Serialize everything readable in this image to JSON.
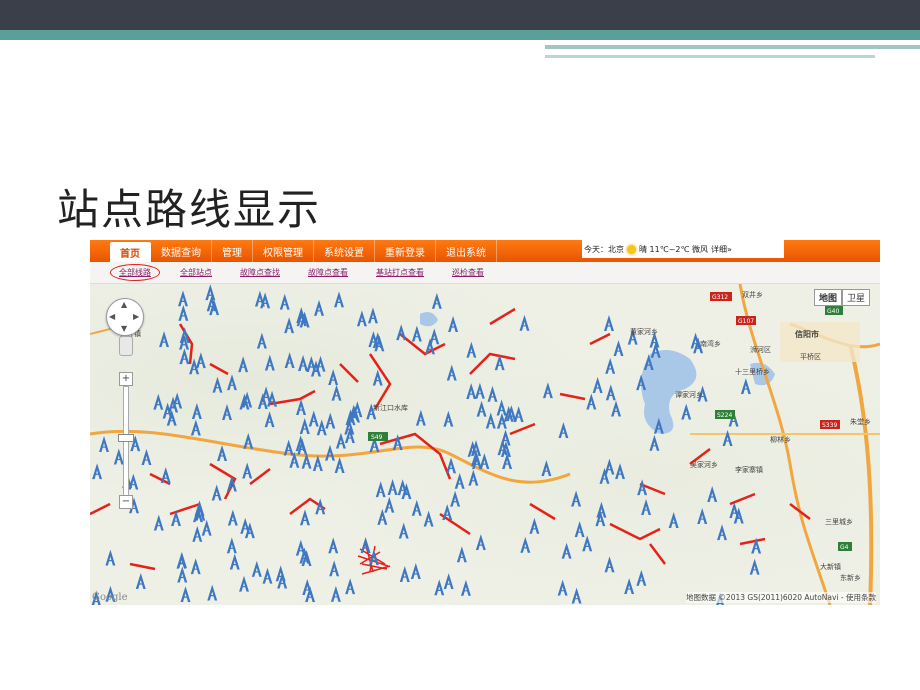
{
  "slide": {
    "title": "站点路线显示"
  },
  "menu": {
    "items": [
      "首页",
      "数据查询",
      "管理",
      "权限管理",
      "系统设置",
      "重新登录",
      "退出系统"
    ],
    "weather": {
      "label": "今天：北京",
      "condition": "晴 11℃~2℃ 微风",
      "details": "详细»"
    }
  },
  "subnav": {
    "items": [
      "全部线路",
      "全部站点",
      "故障点查找",
      "故障点查看",
      "基站打点查看",
      "巡检查看"
    ]
  },
  "map": {
    "type_buttons": [
      "地图",
      "卫星"
    ],
    "copyright": "地图数据 ©2013 GS(2011)6020 AutoNavi - 使用条款",
    "google": "Google",
    "places": [
      "刘升镇",
      "新江口水库",
      "双井乡",
      "董家河乡",
      "信阳市",
      "南湾乡",
      "浉河区",
      "平桥区",
      "十三里桥乡",
      "谭家河乡",
      "柳林乡",
      "吴家河乡",
      "李家寨镇",
      "朱堂乡",
      "三里城乡",
      "大新镇",
      "东新乡"
    ],
    "roads": [
      "S49",
      "G107",
      "G40",
      "G312",
      "S224",
      "S339",
      "G4"
    ],
    "colors": {
      "tower": "#3f78c2",
      "route": "#e3221a",
      "highway": "#f2a640",
      "water": "#a9c8e8"
    }
  }
}
